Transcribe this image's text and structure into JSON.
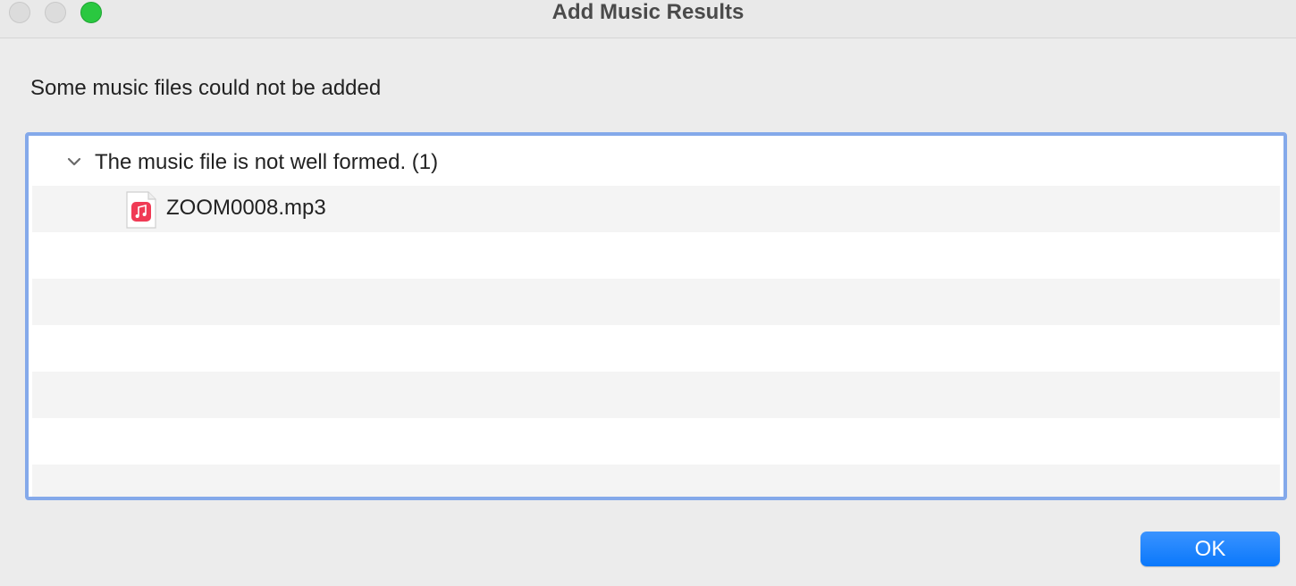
{
  "window": {
    "title": "Add Music Results"
  },
  "dialog": {
    "message": "Some music files could not be added",
    "ok_label": "OK"
  },
  "results": {
    "group_label": "The music file is not well formed. (1)",
    "files": [
      {
        "name": "ZOOM0008.mp3",
        "icon": "music-file-icon"
      }
    ]
  },
  "colors": {
    "accent": "#0a78fb",
    "focus_ring": "#84a9ea",
    "zoom_button": "#2ac840",
    "music_icon": "#f03a55"
  }
}
